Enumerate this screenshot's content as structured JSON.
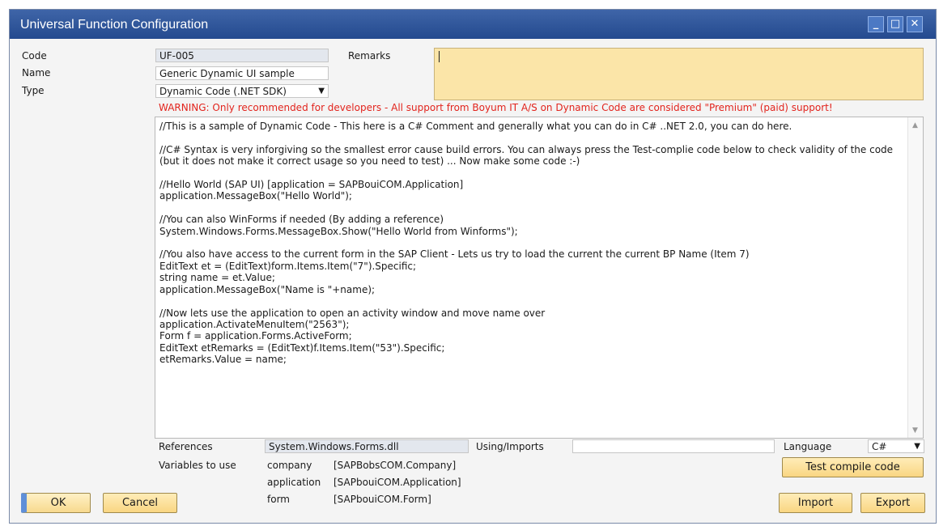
{
  "window": {
    "title": "Universal Function Configuration",
    "controls": {
      "minimize": "_",
      "maximize": "□",
      "close": "✕"
    }
  },
  "form": {
    "code_label": "Code",
    "code_value": "UF-005",
    "name_label": "Name",
    "name_value": "Generic Dynamic UI sample",
    "type_label": "Type",
    "type_value": "Dynamic Code (.NET SDK)",
    "remarks_label": "Remarks",
    "remarks_value": ""
  },
  "warning": "WARNING: Only recommended for developers - All support from Boyum IT A/S on Dynamic Code are considered \"Premium\" (paid) support!",
  "code_text": "//This is a sample of Dynamic Code - This here is a C# Comment and generally what you can do in C# ..NET 2.0, you can do here.\n\n//C# Syntax is very inforgiving so the smallest error cause build errors. You can always press the Test-complie code below to check validity of the code (but it does not make it correct usage so you need to test) ... Now make some code :-)\n\n//Hello World (SAP UI) [application = SAPBouiCOM.Application]\napplication.MessageBox(\"Hello World\");\n\n//You can also WinForms if needed (By adding a reference)\nSystem.Windows.Forms.MessageBox.Show(\"Hello World from Winforms\");\n\n//You also have access to the current form in the SAP Client - Lets us try to load the current the current BP Name (Item 7)\nEditText et = (EditText)form.Items.Item(\"7\").Specific;\nstring name = et.Value;\napplication.MessageBox(\"Name is \"+name);\n\n//Now lets use the application to open an activity window and move name over\napplication.ActivateMenuItem(\"2563\");\nForm f = application.Forms.ActiveForm;\nEditText etRemarks = (EditText)f.Items.Item(\"53\").Specific;\netRemarks.Value = name;",
  "bottom": {
    "references_label": "References",
    "references_value": "System.Windows.Forms.dll",
    "using_label": "Using/Imports",
    "using_value": "",
    "language_label": "Language",
    "language_value": "C#",
    "variables_label": "Variables to use",
    "variables": [
      {
        "name": "company",
        "type": "[SAPBobsCOM.Company]"
      },
      {
        "name": "application",
        "type": "[SAPbouiCOM.Application]"
      },
      {
        "name": "form",
        "type": "[SAPbouiCOM.Form]"
      }
    ]
  },
  "buttons": {
    "test_compile": "Test compile code",
    "ok": "OK",
    "cancel": "Cancel",
    "import": "Import",
    "export": "Export"
  },
  "colors": {
    "titlebar": "#2f569b",
    "remarks_bg": "#fbe5a8",
    "warning": "#e2241d",
    "button": "#f9d682"
  }
}
